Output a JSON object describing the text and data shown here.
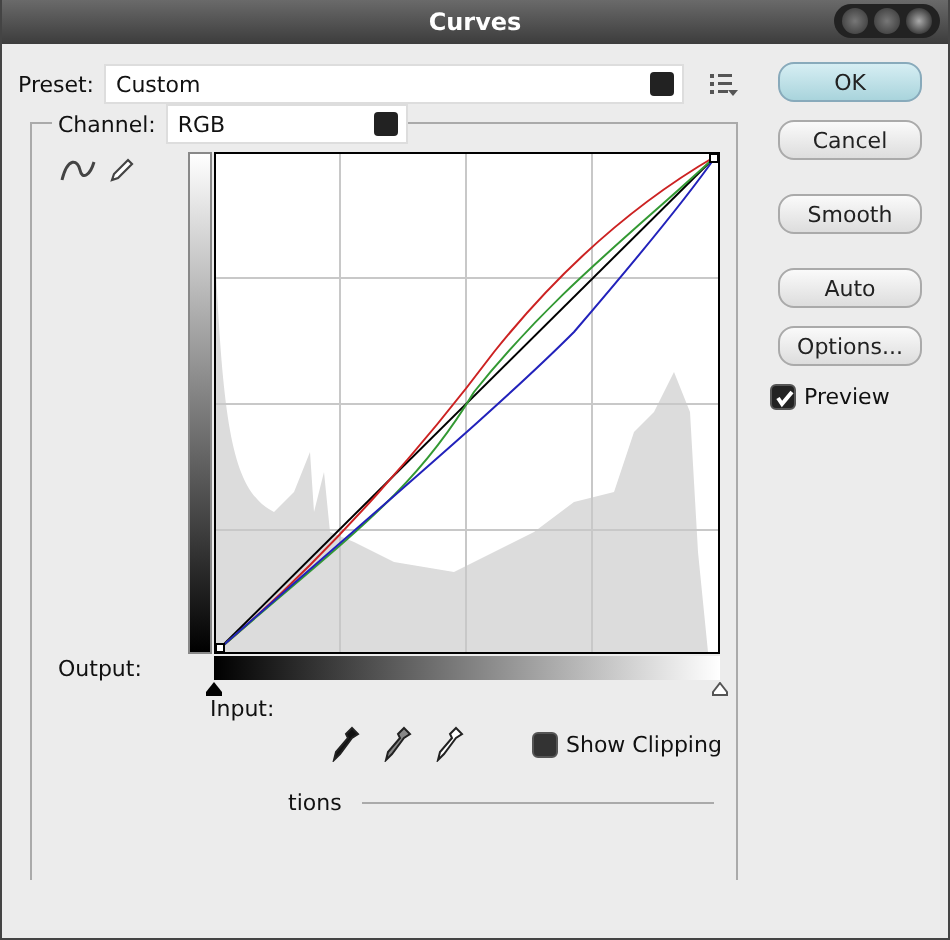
{
  "window": {
    "title": "Curves"
  },
  "preset": {
    "label": "Preset:",
    "value": "Custom"
  },
  "channel": {
    "label": "Channel:",
    "value": "RGB"
  },
  "graph": {
    "output_label": "Output:",
    "input_label": "Input:"
  },
  "show_clipping": {
    "label": "Show Clipping",
    "checked": false
  },
  "display_options": {
    "label": "tions"
  },
  "buttons": [
    {
      "label": "OK",
      "default": true
    },
    {
      "label": "Cancel",
      "default": false
    },
    {
      "label": "Smooth",
      "default": false
    },
    {
      "label": "Auto",
      "default": false
    },
    {
      "label": "Options...",
      "default": false
    }
  ],
  "preview": {
    "label": "Preview",
    "checked": true
  }
}
